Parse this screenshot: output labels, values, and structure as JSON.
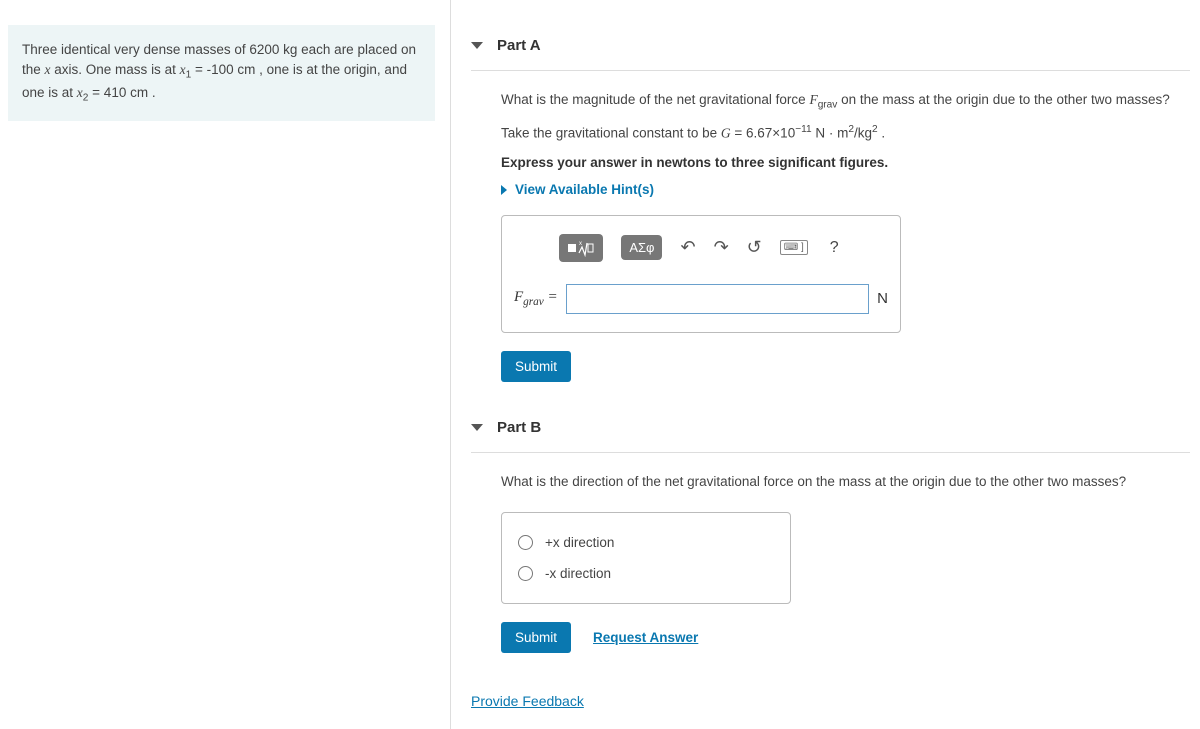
{
  "problem": {
    "text_html": "Three identical very dense masses of 6200 <span class='rm'>kg</span> each are placed on the <span class='math-var'>x</span> axis. One mass is at <span class='math-var'>x</span><sub>1</sub> = -100 <span class='rm'>cm</span> , one is at the origin, and one is at <span class='math-var'>x</span><sub>2</sub> = 410 <span class='rm'>cm</span> ."
  },
  "partA": {
    "title": "Part A",
    "q1_html": "What is the magnitude of the net gravitational force <span class='math-var'>F</span><sub>grav</sub> on the mass at the origin due to the other two masses?",
    "q2_html": "Take the gravitational constant to be <span class='math-var'>G</span> = 6.67×10<sup>−11</sup> <span class='rm'>N · m</span><sup>2</sup>/<span class='rm'>kg</span><sup>2</sup> .",
    "q3": "Express your answer in newtons to three significant figures.",
    "hints": "View Available Hint(s)",
    "prefix_html": "<span class='math-var'>F</span><sub>grav</sub> =",
    "unit": "N",
    "submit": "Submit",
    "tool_greek": "ΑΣφ"
  },
  "partB": {
    "title": "Part B",
    "q1": "What is the direction of the net gravitational force on the mass at the origin due to the other two masses?",
    "opt1": "+x direction",
    "opt2": "-x direction",
    "submit": "Submit",
    "request": "Request Answer"
  },
  "feedback": "Provide Feedback"
}
